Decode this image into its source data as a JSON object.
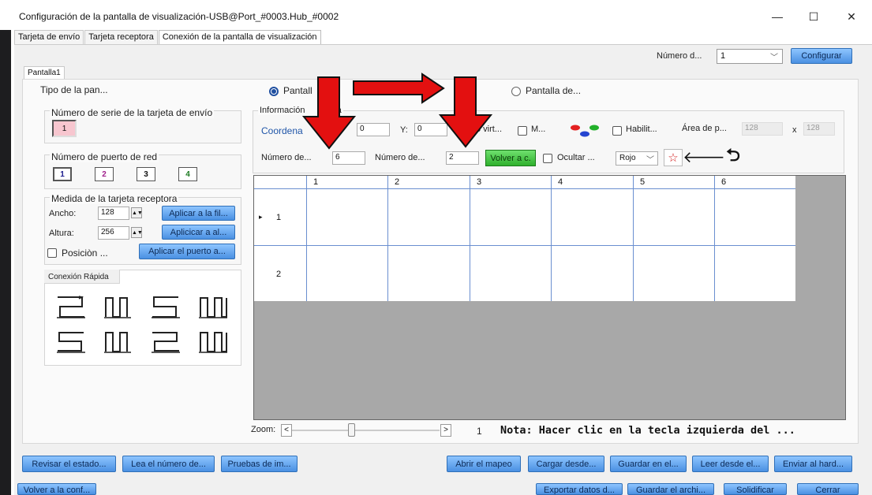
{
  "window": {
    "title": "Configuración de la pantalla de visualización-USB@Port_#0003.Hub_#0002",
    "minimize": "—",
    "maximize": "☐",
    "close": "✕"
  },
  "tabs": [
    {
      "label": "Tarjeta de envío"
    },
    {
      "label": "Tarjeta receptora"
    },
    {
      "label": "Conexión de la pantalla de visualización"
    }
  ],
  "top_controls": {
    "numero_label": "Número d...",
    "numero_value": "1",
    "configurar": "Configurar"
  },
  "subtab": "Pantalla1",
  "tipo_label": "Tipo de la pan...",
  "serie_group": {
    "title": "Número de serie de la tarjeta de envío",
    "value": "1"
  },
  "puerto_group": {
    "title": "Número de puerto de red",
    "ports": [
      {
        "label": "1",
        "color": "#1a1a8c"
      },
      {
        "label": "2",
        "color": "#a0208c"
      },
      {
        "label": "3",
        "color": "#111111"
      },
      {
        "label": "4",
        "color": "#1d7a22"
      }
    ]
  },
  "medida_group": {
    "title": "Medida de la tarjeta receptora",
    "ancho_label": "Ancho:",
    "ancho_value": "128",
    "altura_label": "Altura:",
    "altura_value": "256",
    "aplicar_fila": "Aplicar a la fil...",
    "aplicar_al": "Aplicicar a al...",
    "posicion_label": "Posiciòn ...",
    "aplicar_puerto": "Aplicar el puerto a..."
  },
  "conexion_rapida": {
    "title": "Conexión Rápida"
  },
  "radio_options": {
    "pantalla1": "Pantall",
    "pantalla2": "Pantalla de..."
  },
  "info_group": {
    "title_prefix": "Información",
    "title_suffix": "a",
    "coord_label": "Coordena",
    "x_value": "0",
    "y_label": "Y:",
    "y_value": "0",
    "virt_label": "o virt...",
    "m_label": "M...",
    "habilit_label": "Habilit...",
    "area_label": "Área de p...",
    "area_w": "128",
    "area_x": "x",
    "area_h": "128",
    "numero1_label": "Número de...",
    "numero1_value": "6",
    "numero2_label": "Número de...",
    "numero2_value": "2",
    "volver_btn": "Volver a c.",
    "ocultar_label": "Ocultar ...",
    "color_select": "Rojo",
    "star_icon": "☆",
    "back_arrow": "🡐",
    "undo_icon": "⮌"
  },
  "grid": {
    "columns": [
      "1",
      "2",
      "3",
      "4",
      "5",
      "6"
    ],
    "rows": [
      "1",
      "2"
    ],
    "row_marker": "▸"
  },
  "zoom": {
    "label": "Zoom:",
    "left": "<",
    "right": ">",
    "value": "1"
  },
  "nota": "Nota: Hacer clic en la tecla izquierda del ...",
  "bottom_buttons_row1": {
    "revisar": "Revisar el estado...",
    "lea": "Lea el número de...",
    "pruebas": "Pruebas de im...",
    "abrir": "Abrir el mapeo",
    "cargar": "Cargar desde...",
    "guardar_en": "Guardar en el...",
    "leer": "Leer desde el...",
    "enviar": "Enviar al hard..."
  },
  "bottom_buttons_row2": {
    "volver_conf": "Volver a la conf...",
    "exportar": "Exportar datos d...",
    "guardar_archi": "Guardar el archi...",
    "solidificar": "Solidificar",
    "cerrar": "Cerrar"
  },
  "colors": {
    "accent_blue": "#4a90e2",
    "annotation_red": "#e31010",
    "volver_green": "#38c43a",
    "grid_line": "#6a8fd0"
  }
}
